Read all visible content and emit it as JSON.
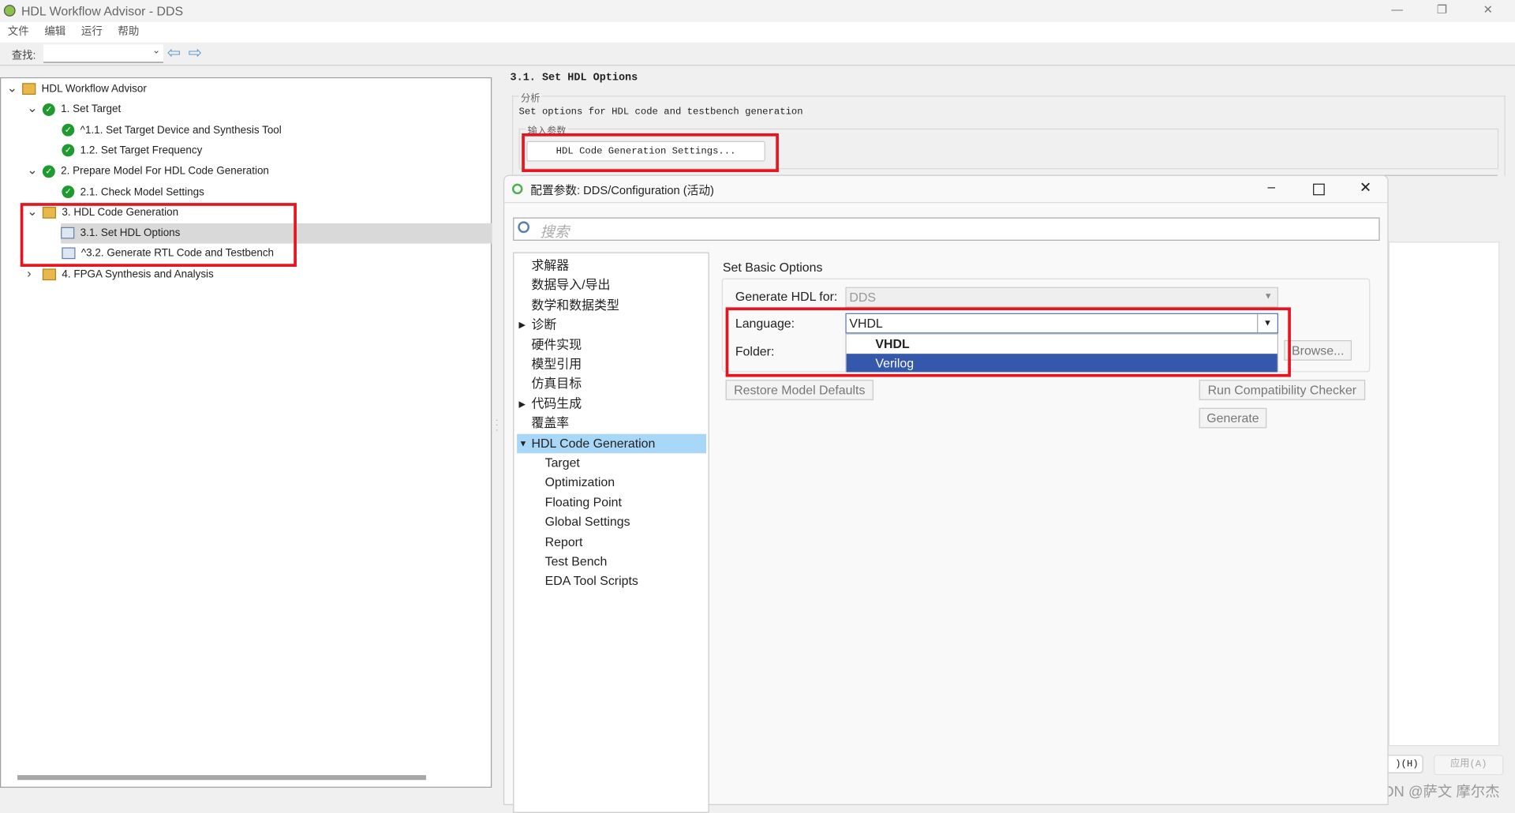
{
  "window": {
    "title": "HDL Workflow Advisor - DDS",
    "controls": [
      "—",
      "❐",
      "✕"
    ]
  },
  "menu": [
    "文件",
    "编辑",
    "运行",
    "帮助"
  ],
  "toolbar": {
    "find_label": "查找:",
    "find_value": ""
  },
  "tree": [
    {
      "label": "HDL Workflow Advisor",
      "level": 0,
      "icon": "folder-icon",
      "expanded": true
    },
    {
      "label": "1. Set Target",
      "level": 1,
      "icon": "check-icon",
      "expanded": true
    },
    {
      "label": "^1.1. Set Target Device and Synthesis Tool",
      "level": 2,
      "icon": "check-icon"
    },
    {
      "label": "1.2. Set Target Frequency",
      "level": 2,
      "icon": "check-icon"
    },
    {
      "label": "2. Prepare Model For HDL Code Generation",
      "level": 1,
      "icon": "check-icon",
      "expanded": true
    },
    {
      "label": "2.1. Check Model Settings",
      "level": 2,
      "icon": "check-icon"
    },
    {
      "label": "3. HDL Code Generation",
      "level": 1,
      "icon": "folder-icon",
      "expanded": true
    },
    {
      "label": "3.1. Set HDL Options",
      "level": 2,
      "icon": "task-icon",
      "selected": true
    },
    {
      "label": "^3.2. Generate RTL Code and Testbench",
      "level": 2,
      "icon": "task-icon"
    },
    {
      "label": "4. FPGA Synthesis and Analysis",
      "level": 1,
      "icon": "folder-icon",
      "expanded": false
    }
  ],
  "task": {
    "title": "3.1. Set HDL Options",
    "analysis_legend": "分析",
    "description": "Set options for HDL code and testbench generation",
    "input_legend": "输入参数",
    "settings_button": "HDL Code Generation Settings...",
    "help_button": ")(H)",
    "apply_button": "应用(A)"
  },
  "dialog": {
    "title": "配置参数: DDS/Configuration (活动)",
    "search_placeholder": "搜索",
    "nav": [
      {
        "label": "求解器",
        "level": 0
      },
      {
        "label": "数据导入/导出",
        "level": 0
      },
      {
        "label": "数学和数据类型",
        "level": 0
      },
      {
        "label": "诊断",
        "level": 0,
        "arrow": "▶"
      },
      {
        "label": "硬件实现",
        "level": 0
      },
      {
        "label": "模型引用",
        "level": 0
      },
      {
        "label": "仿真目标",
        "level": 0
      },
      {
        "label": "代码生成",
        "level": 0,
        "arrow": "▶"
      },
      {
        "label": "覆盖率",
        "level": 0
      },
      {
        "label": "HDL Code Generation",
        "level": 0,
        "arrow": "▼",
        "selected": true
      },
      {
        "label": "Target",
        "level": 1
      },
      {
        "label": "Optimization",
        "level": 1
      },
      {
        "label": "Floating Point",
        "level": 1
      },
      {
        "label": "Global Settings",
        "level": 1
      },
      {
        "label": "Report",
        "level": 1
      },
      {
        "label": "Test Bench",
        "level": 1
      },
      {
        "label": "EDA Tool Scripts",
        "level": 1
      }
    ],
    "section_title": "Set Basic Options",
    "generate_for_label": "Generate HDL for:",
    "generate_for_value": "DDS",
    "language_label": "Language:",
    "language_value": "VHDL",
    "language_options": [
      "VHDL",
      "Verilog"
    ],
    "highlighted_option": "Verilog",
    "folder_label": "Folder:",
    "browse_button": "Browse...",
    "restore_button": "Restore Model Defaults",
    "compat_button": "Run Compatibility Checker",
    "generate_button": "Generate"
  },
  "watermark": "CSDN @萨文 摩尔杰",
  "colors": {
    "highlight": "#3558ac",
    "annotation_red": "#e8141d",
    "nav_selected": "#a9d7f7"
  }
}
